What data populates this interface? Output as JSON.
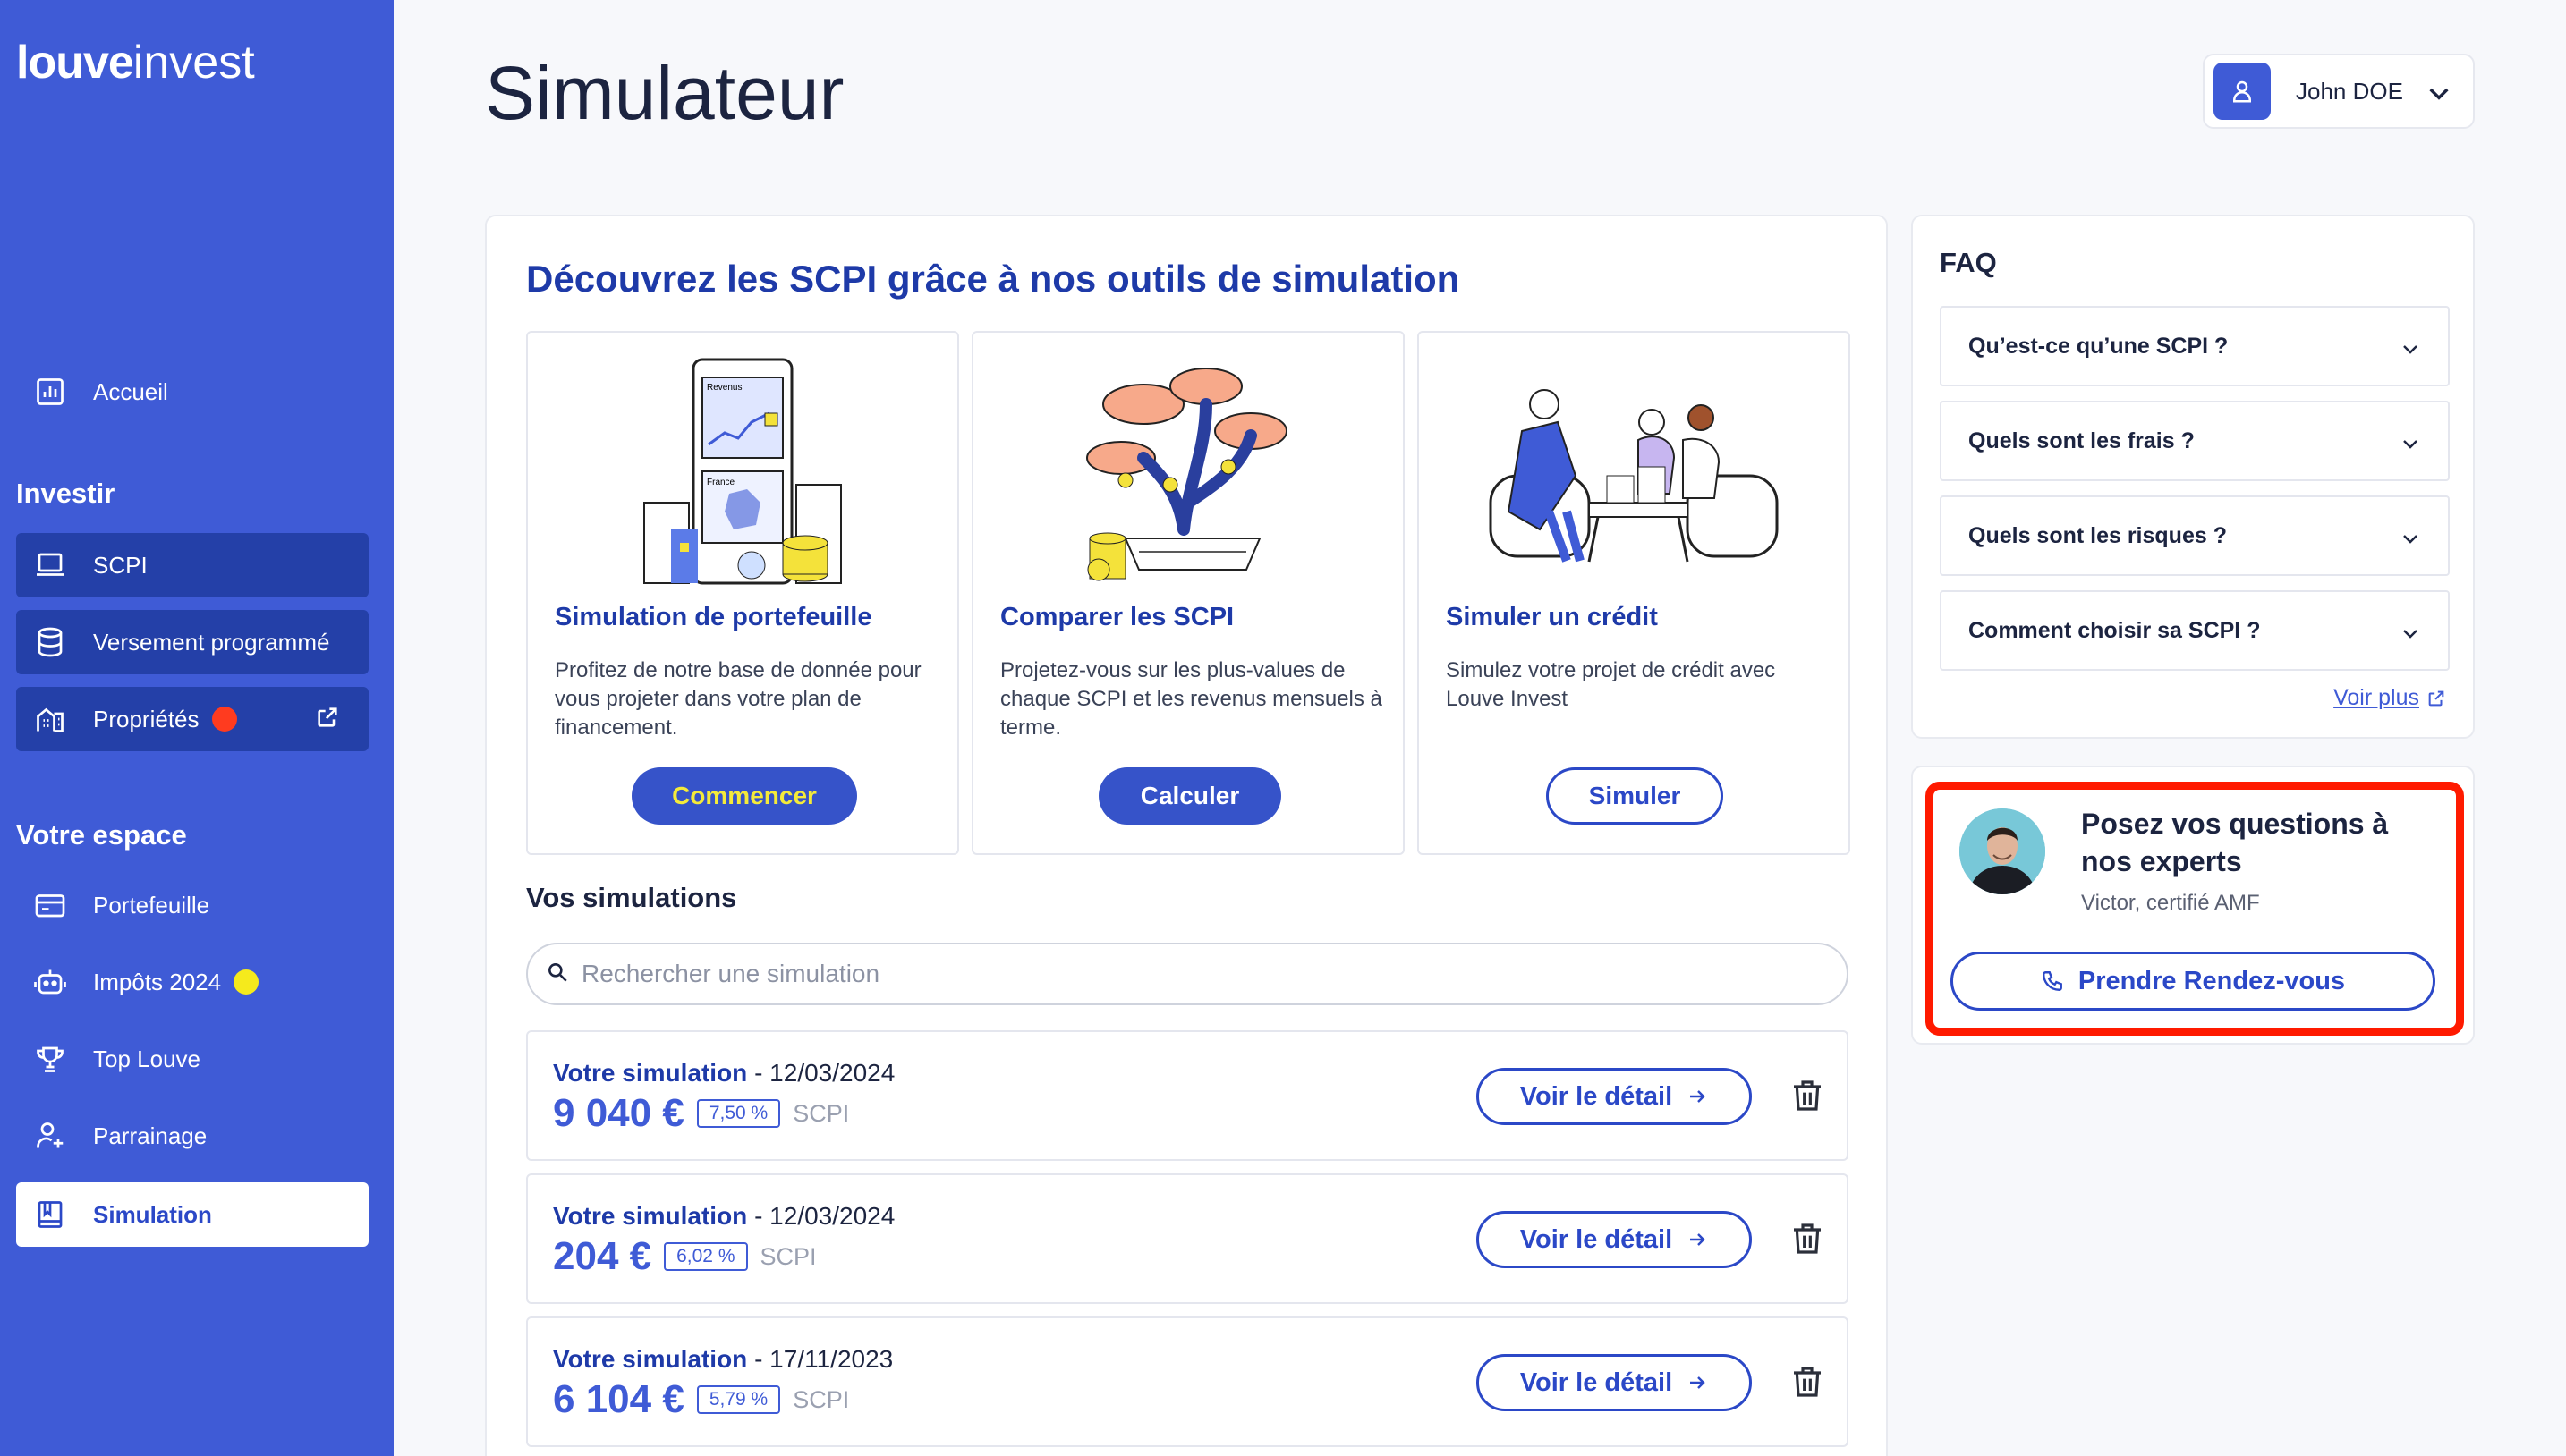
{
  "brand": {
    "logo_bold": "louve",
    "logo_light": "invest"
  },
  "sidebar": {
    "home": "Accueil",
    "invest_title": "Investir",
    "invest_items": [
      {
        "label": "SCPI",
        "icon": "laptop-icon"
      },
      {
        "label": "Versement programmé",
        "icon": "database-icon"
      },
      {
        "label": "Propriétés",
        "icon": "building-icon",
        "badge_color": "#ff3b1f"
      }
    ],
    "space_title": "Votre espace",
    "space_items": [
      {
        "label": "Portefeuille",
        "icon": "wallet-icon"
      },
      {
        "label": "Impôts 2024",
        "icon": "robot-icon",
        "badge_color": "#f5ea1c"
      },
      {
        "label": "Top Louve",
        "icon": "trophy-icon"
      },
      {
        "label": "Parrainage",
        "icon": "user-plus-icon"
      },
      {
        "label": "Simulation",
        "icon": "book-icon",
        "active": true
      }
    ]
  },
  "header": {
    "title": "Simulateur",
    "user_name": "John DOE"
  },
  "main": {
    "heading": "Découvrez les SCPI grâce à nos outils de simulation",
    "tools": [
      {
        "title": "Simulation de portefeuille",
        "description": "Profitez de notre base de donnée pour vous projeter dans votre plan de financement.",
        "button": "Commencer"
      },
      {
        "title": "Comparer les SCPI",
        "description": "Projetez-vous sur les plus-values de chaque SCPI et les revenus mensuels à terme.",
        "button": "Calculer"
      },
      {
        "title": "Simuler un crédit",
        "description": "Simulez votre projet de crédit avec Louve Invest",
        "button": "Simuler"
      }
    ],
    "illustration_labels": {
      "revenus": "Revenus",
      "france": "France"
    },
    "simulations_title": "Vos simulations",
    "search_placeholder": "Rechercher une simulation",
    "simulations": [
      {
        "label": "Votre simulation",
        "date": " - 12/03/2024",
        "amount": "9 040 €",
        "rate": "7,50 %",
        "type": "SCPI"
      },
      {
        "label": "Votre simulation",
        "date": " - 12/03/2024",
        "amount": "204 €",
        "rate": "6,02 %",
        "type": "SCPI"
      },
      {
        "label": "Votre simulation",
        "date": " - 17/11/2023",
        "amount": "6 104 €",
        "rate": "5,79 %",
        "type": "SCPI"
      }
    ],
    "detail_button": "Voir le détail"
  },
  "faq": {
    "title": "FAQ",
    "items": [
      "Qu’est-ce qu’une SCPI ?",
      "Quels sont les frais ?",
      "Quels sont les risques ?",
      "Comment choisir sa SCPI ?"
    ],
    "more": "Voir plus"
  },
  "expert": {
    "title": "Posez vos questions à nos experts",
    "subtitle": "Victor, certifié AMF",
    "button": "Prendre Rendez-vous"
  },
  "colors": {
    "primary": "#3f5bd6",
    "dark_blue": "#1e3aa8",
    "highlight": "#ff1a00"
  }
}
